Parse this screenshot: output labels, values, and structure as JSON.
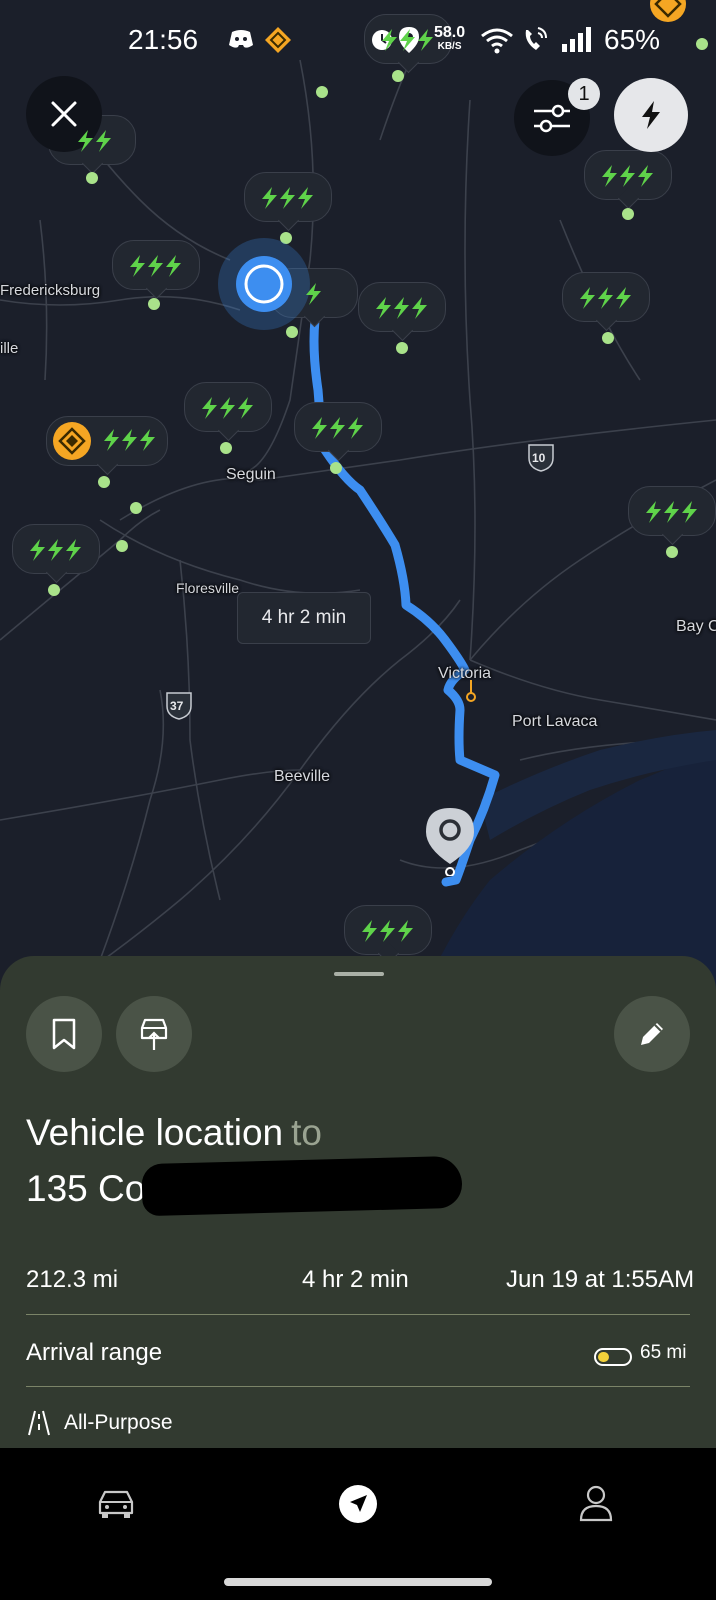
{
  "status_bar": {
    "time": "21:56",
    "net_speed": "58.0",
    "net_unit": "KB/S",
    "battery": "65%"
  },
  "map": {
    "cities": [
      "Fredericksburg",
      "ille",
      "Seguin",
      "Floresville",
      "Victoria",
      "Port Lavaca",
      "Beeville",
      "Bay C"
    ],
    "highways": [
      "10",
      "37"
    ],
    "eta_label": "4 hr 2 min",
    "filter_badge": "1"
  },
  "route": {
    "origin": "Vehicle location",
    "connector": "to",
    "destination": "135  Co",
    "distance": "212.3 mi",
    "duration": "4 hr 2 min",
    "arrival": "Jun 19 at 1:55AM",
    "arrival_range_label": "Arrival range",
    "arrival_range_value": "65 mi",
    "arrival_range_fraction": 0.35,
    "mode": "All-Purpose"
  },
  "colors": {
    "route": "#3d8ef0",
    "charger": "#5fd34a",
    "sheet": "#323a30",
    "map": "#1b1f2a"
  }
}
